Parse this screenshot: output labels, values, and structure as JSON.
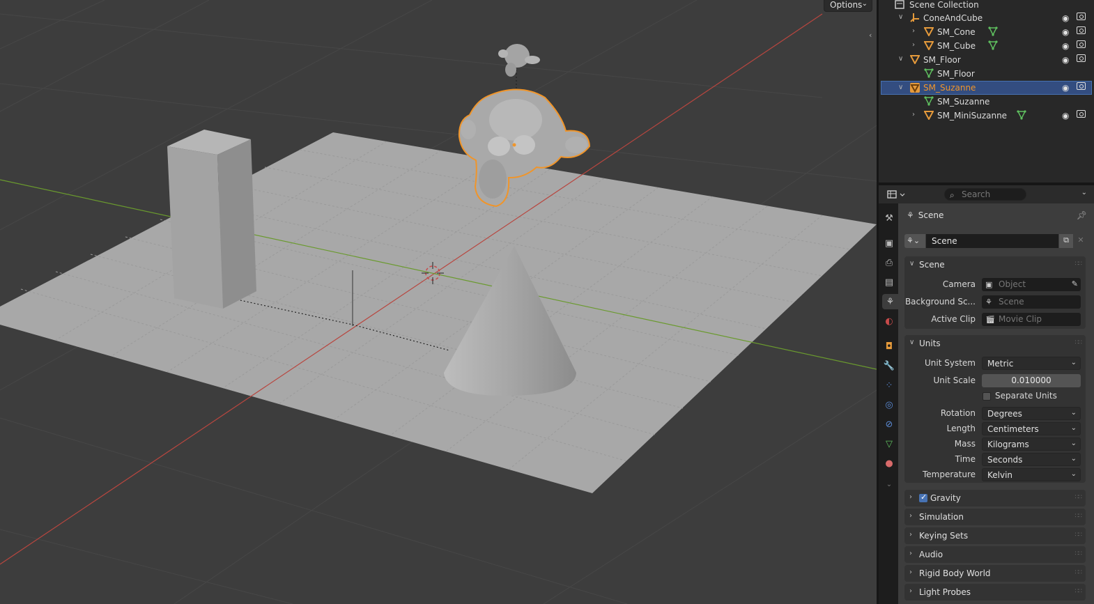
{
  "viewport": {
    "options_label": "Options"
  },
  "outliner": {
    "rows": [
      {
        "label": "Scene Collection"
      },
      {
        "label": "ConeAndCube"
      },
      {
        "label": "SM_Cone"
      },
      {
        "label": "SM_Cube"
      },
      {
        "label": "SM_Floor"
      },
      {
        "label": "SM_Floor"
      },
      {
        "label": "SM_Suzanne"
      },
      {
        "label": "SM_Suzanne"
      },
      {
        "label": "SM_MiniSuzanne"
      }
    ]
  },
  "properties": {
    "search_placeholder": "Search",
    "context_title": "Scene",
    "datablock_name": "Scene",
    "scene_panel": {
      "title": "Scene",
      "camera_label": "Camera",
      "camera_placeholder": "Object",
      "background_label": "Background Sc...",
      "background_placeholder": "Scene",
      "clip_label": "Active Clip",
      "clip_placeholder": "Movie Clip"
    },
    "units_panel": {
      "title": "Units",
      "unit_system_label": "Unit System",
      "unit_system_value": "Metric",
      "unit_scale_label": "Unit Scale",
      "unit_scale_value": "0.010000",
      "separate_units_label": "Separate Units",
      "rotation_label": "Rotation",
      "rotation_value": "Degrees",
      "length_label": "Length",
      "length_value": "Centimeters",
      "mass_label": "Mass",
      "mass_value": "Kilograms",
      "time_label": "Time",
      "time_value": "Seconds",
      "temperature_label": "Temperature",
      "temperature_value": "Kelvin"
    },
    "collapsed_panels": {
      "gravity": "Gravity",
      "simulation": "Simulation",
      "keying_sets": "Keying Sets",
      "audio": "Audio",
      "rigid_body_world": "Rigid Body World",
      "light_probes": "Light Probes"
    }
  },
  "colors": {
    "selection_outline": "#f0952a",
    "x_axis": "#b8463f",
    "y_axis": "#6a9a2e",
    "selected_row": "#334d80"
  }
}
